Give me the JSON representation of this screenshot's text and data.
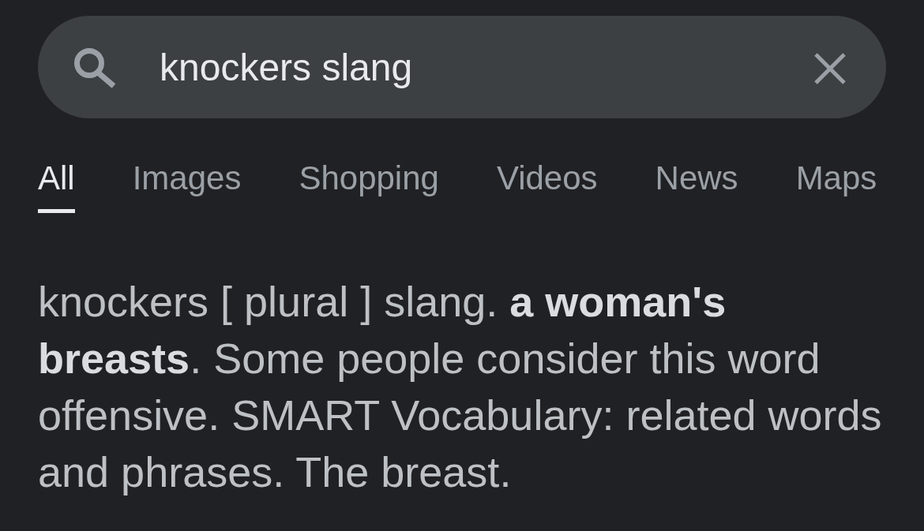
{
  "search": {
    "value": "knockers slang"
  },
  "tabs": [
    {
      "label": "All",
      "selected": true
    },
    {
      "label": "Images",
      "selected": false
    },
    {
      "label": "Shopping",
      "selected": false
    },
    {
      "label": "Videos",
      "selected": false
    },
    {
      "label": "News",
      "selected": false
    },
    {
      "label": "Maps",
      "selected": false
    }
  ],
  "result": {
    "text": "knockers [ plural ] slang. **a woman's breasts**. Some people consider this word offensive. SMART Vocabulary: related words and phrases. The breast."
  }
}
